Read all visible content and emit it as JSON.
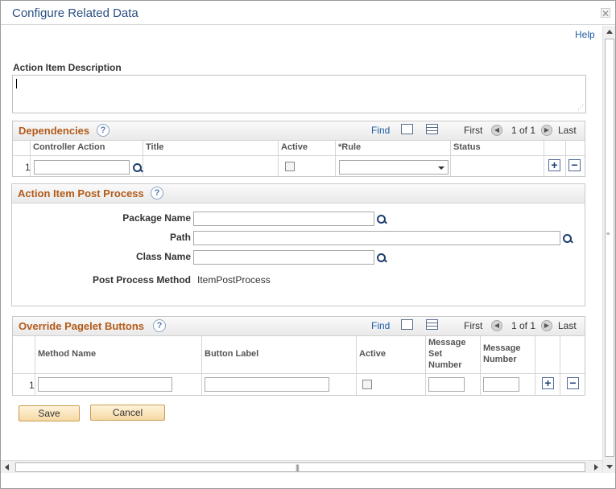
{
  "window": {
    "title": "Configure Related Data",
    "close_glyph": "✕"
  },
  "help": {
    "label": "Help"
  },
  "description": {
    "label": "Action Item Description",
    "value": ""
  },
  "dependencies": {
    "title": "Dependencies",
    "nav": {
      "find": "Find",
      "first": "First",
      "range": "1 of 1",
      "last": "Last"
    },
    "columns": [
      "Controller Action",
      "Title",
      "Active",
      "*Rule",
      "Status"
    ],
    "row": {
      "num": "1",
      "controller_action": "",
      "title": "",
      "active": false,
      "rule": "",
      "status": ""
    }
  },
  "post_process": {
    "title": "Action Item Post Process",
    "package_name_label": "Package Name",
    "path_label": "Path",
    "class_name_label": "Class Name",
    "method_label": "Post Process Method",
    "method_value": "ItemPostProcess"
  },
  "override": {
    "title": "Override Pagelet Buttons",
    "nav": {
      "find": "Find",
      "first": "First",
      "range": "1 of 1",
      "last": "Last"
    },
    "columns": {
      "method_name": "Method Name",
      "button_label": "Button Label",
      "active": "Active",
      "msg_set_1": "Message",
      "msg_set_2": "Set",
      "msg_set_3": "Number",
      "msg_num_1": "Message",
      "msg_num_2": "Number"
    },
    "row": {
      "num": "1"
    }
  },
  "buttons": {
    "save": "Save",
    "cancel": "Cancel"
  },
  "icons": {
    "help": "question-icon",
    "add": "+",
    "remove": "−",
    "prev": "◀",
    "next": "▶",
    "grip": "|||"
  }
}
